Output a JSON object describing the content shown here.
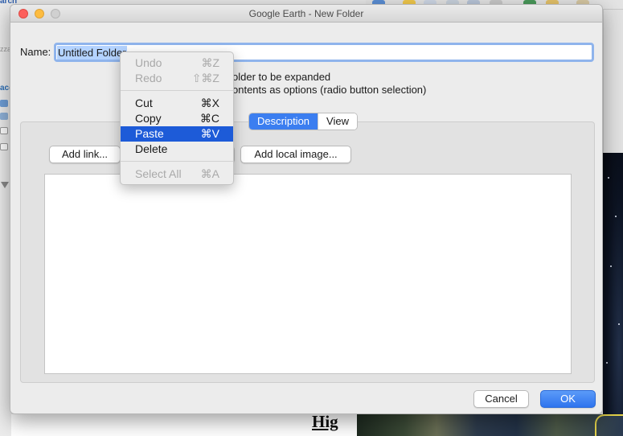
{
  "window": {
    "title": "Google Earth - New Folder"
  },
  "background": {
    "left_fragment_top": "arch",
    "left_fragment_mid": "ace",
    "left_fragment_faint": "zza",
    "bottom_heading_fragment": "Hig"
  },
  "form": {
    "name_label": "Name:",
    "name_value": "Untitled Folder",
    "option_expand_text": "older to be expanded",
    "option_radio_text": "ontents as options (radio button selection)"
  },
  "tabs": [
    {
      "label": "Description",
      "active": true
    },
    {
      "label": "View",
      "active": false
    }
  ],
  "toolbar": {
    "add_link_label": "Add link...",
    "add_local_image_label": "Add local image..."
  },
  "description": {
    "text": ""
  },
  "footer": {
    "cancel_label": "Cancel",
    "ok_label": "OK"
  },
  "context_menu": {
    "items": [
      {
        "label": "Undo",
        "shortcut": "⌘Z",
        "enabled": false
      },
      {
        "label": "Redo",
        "shortcut": "⇧⌘Z",
        "enabled": false
      },
      {
        "label": "Cut",
        "shortcut": "⌘X",
        "enabled": true
      },
      {
        "label": "Copy",
        "shortcut": "⌘C",
        "enabled": true
      },
      {
        "label": "Paste",
        "shortcut": "⌘V",
        "enabled": true,
        "highlighted": true
      },
      {
        "label": "Delete",
        "shortcut": "",
        "enabled": true
      },
      {
        "label": "Select All",
        "shortcut": "⌘A",
        "enabled": false
      }
    ]
  },
  "colors": {
    "accent": "#3b7ef0",
    "menu_highlight": "#1d5bd8",
    "focus_ring": "#8fb4ec",
    "selection": "#b4d3ff"
  }
}
